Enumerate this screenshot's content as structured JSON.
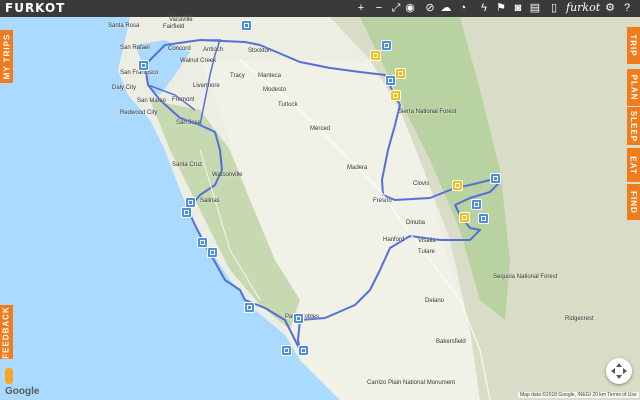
{
  "app": {
    "logo": "FURKOT",
    "brand": "furkot"
  },
  "toolbar": {
    "icons": [
      "plus-icon",
      "minus-icon",
      "fullscreen-icon",
      "target-icon",
      "no-entry-icon",
      "weather-icon",
      "clock-icon",
      "bolt-icon",
      "flag-icon",
      "camera-icon",
      "layers-icon",
      "phone-icon",
      "gear-icon",
      "help-icon"
    ]
  },
  "tabs_right": [
    "TRIP",
    "PLAN",
    "SLEEP",
    "EAT",
    "FIND"
  ],
  "tabs_left": [
    "MY TRIPS",
    "FEEDBACK"
  ],
  "cities": [
    {
      "name": "Santa Rosa"
    },
    {
      "name": "Fairfield"
    },
    {
      "name": "Vacaville"
    },
    {
      "name": "Stockton"
    },
    {
      "name": "San Rafael"
    },
    {
      "name": "Concord"
    },
    {
      "name": "Walnut Creek"
    },
    {
      "name": "Antioch"
    },
    {
      "name": "San Francisco"
    },
    {
      "name": "Daly City"
    },
    {
      "name": "San Mateo"
    },
    {
      "name": "Fremont"
    },
    {
      "name": "Livermore"
    },
    {
      "name": "Tracy"
    },
    {
      "name": "Manteca"
    },
    {
      "name": "Modesto"
    },
    {
      "name": "Turlock"
    },
    {
      "name": "Redwood City"
    },
    {
      "name": "San Jose"
    },
    {
      "name": "Merced"
    },
    {
      "name": "Santa Cruz"
    },
    {
      "name": "Watsonville"
    },
    {
      "name": "Madera"
    },
    {
      "name": "Salinas"
    },
    {
      "name": "Clovis"
    },
    {
      "name": "Fresno"
    },
    {
      "name": "Dinuba"
    },
    {
      "name": "Hanford"
    },
    {
      "name": "Visalia"
    },
    {
      "name": "Tulare"
    },
    {
      "name": "Delano"
    },
    {
      "name": "Bakersfield"
    },
    {
      "name": "Ridgecrest"
    },
    {
      "name": "Paso Robles"
    },
    {
      "name": "Sequoia National Forest"
    },
    {
      "name": "Sierra National Forest"
    },
    {
      "name": "Carrizo Plain National Monument"
    }
  ],
  "footer": {
    "attribution": "Map data ©2018 Google, INEGI  20 km  Terms of Use",
    "google": "Google"
  },
  "colors": {
    "route": "#5470d8",
    "accent": "#f07d1d",
    "topbar": "#3a3a3a",
    "marker_blue": "#4a8fe0",
    "marker_yellow": "#f3c017"
  }
}
